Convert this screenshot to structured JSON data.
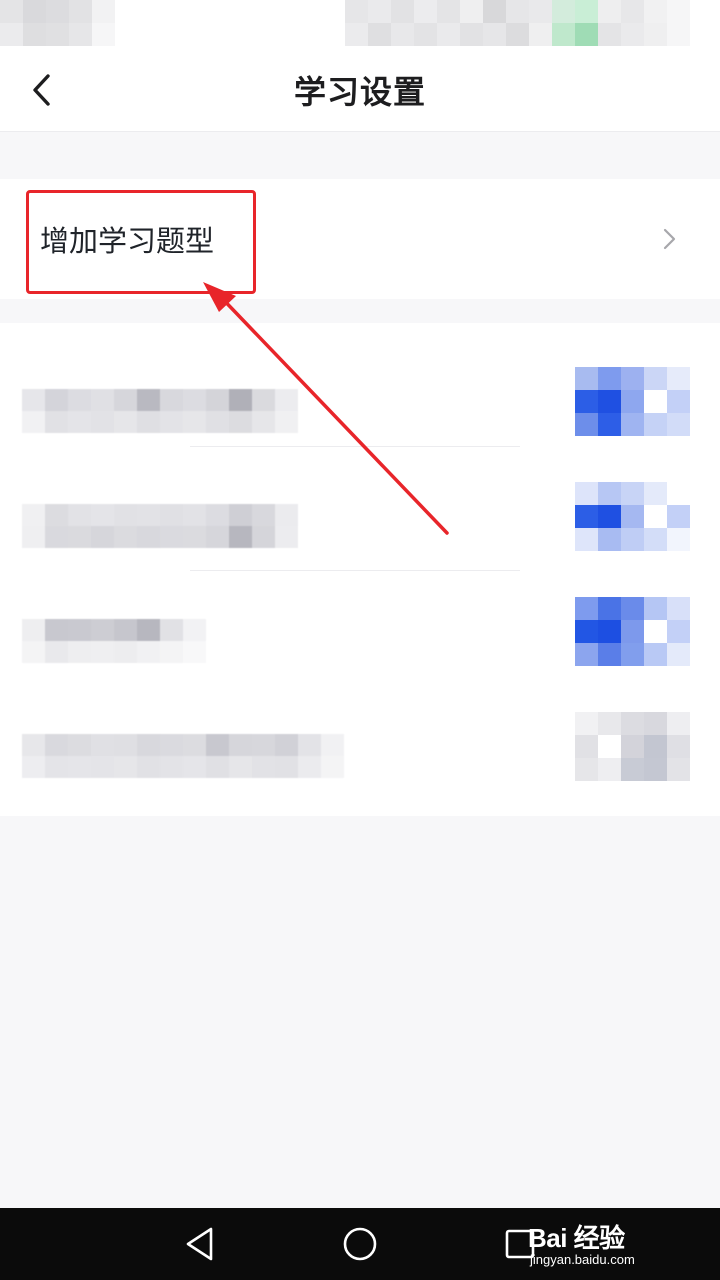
{
  "header": {
    "title": "学习设置",
    "back_icon": "chevron-left-icon"
  },
  "add_row": {
    "label": "增加学习题型",
    "chevron_icon": "chevron-right-icon"
  },
  "settings": {
    "rows": [
      {
        "label_obscured": true,
        "toggle_state": "on"
      },
      {
        "label_obscured": true,
        "toggle_state": "on"
      },
      {
        "label_obscured": true,
        "toggle_state": "on"
      },
      {
        "label_obscured": true,
        "toggle_state": "off"
      }
    ]
  },
  "annotation": {
    "color": "#e8252a",
    "shape": "rectangle-with-arrow"
  },
  "nav_bar": {
    "back_icon": "triangle-back-icon",
    "home_icon": "circle-home-icon",
    "recents_icon": "square-recents-icon"
  },
  "watermark": {
    "brand": "Bai 经验",
    "site": "jingyan.baidu.com"
  },
  "colors": {
    "accent_blue": "#2c5ee6",
    "background": "#f7f7f9",
    "surface": "#ffffff"
  }
}
